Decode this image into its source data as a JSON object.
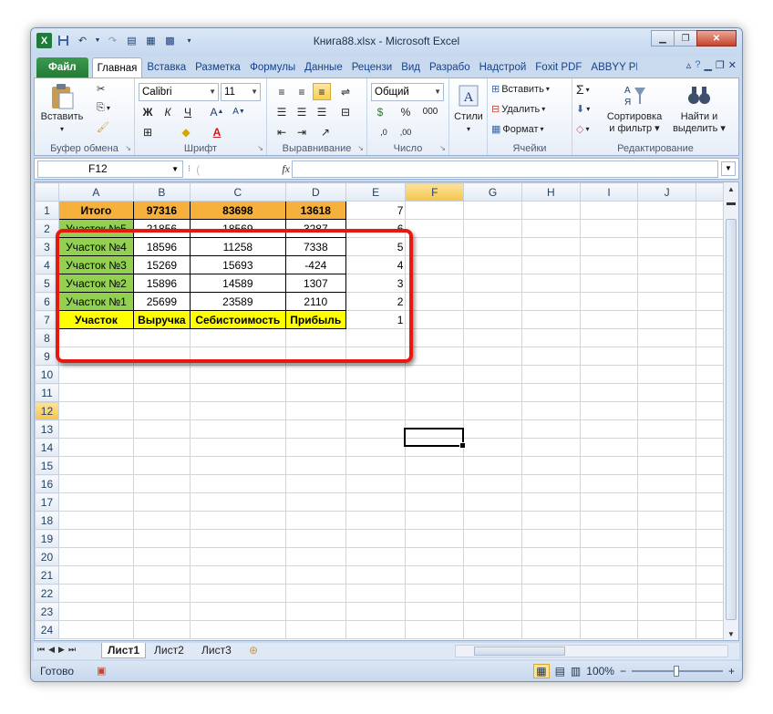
{
  "window": {
    "title": "Книга88.xlsx - Microsoft Excel"
  },
  "icons": {
    "app": "excel-icon",
    "save": "save-icon",
    "undo": "undo-icon",
    "redo": "redo-icon"
  },
  "tabs": [
    {
      "label": "Файл"
    },
    {
      "label": "Главная"
    },
    {
      "label": "Вставка"
    },
    {
      "label": "Разметка"
    },
    {
      "label": "Формулы"
    },
    {
      "label": "Данные"
    },
    {
      "label": "Рецензи"
    },
    {
      "label": "Вид"
    },
    {
      "label": "Разрабо"
    },
    {
      "label": "Надстрой"
    },
    {
      "label": "Foxit PDF"
    },
    {
      "label": "ABBYY PD"
    }
  ],
  "ribbon": {
    "clipboard": {
      "label": "Буфер обмена",
      "paste": "Вставить"
    },
    "font": {
      "label": "Шрифт",
      "name": "Calibri",
      "size": "11",
      "bold": "Ж",
      "italic": "К",
      "underline": "Ч"
    },
    "alignment": {
      "label": "Выравнивание"
    },
    "number": {
      "label": "Число",
      "format": "Общий",
      "percent": "%",
      "thousands": "000"
    },
    "styles": {
      "label": "Стили"
    },
    "cells": {
      "label": "Ячейки",
      "insert": "Вставить",
      "delete": "Удалить",
      "format": "Формат"
    },
    "editing": {
      "label": "Редактирование",
      "sort_line1": "Сортировка",
      "sort_line2": "и фильтр",
      "find_line1": "Найти и",
      "find_line2": "выделить",
      "sum": "Σ"
    }
  },
  "formula_bar": {
    "name_box": "F12",
    "fx": "fx",
    "value": ""
  },
  "grid": {
    "columns": [
      "A",
      "B",
      "C",
      "D",
      "E",
      "F",
      "G",
      "H",
      "I",
      "J"
    ],
    "rows": [
      {
        "n": "1",
        "cells": [
          "Итого",
          "97316",
          "83698",
          "13618",
          "7"
        ]
      },
      {
        "n": "2",
        "cells": [
          "Участок №5",
          "21856",
          "18569",
          "3287",
          "6"
        ]
      },
      {
        "n": "3",
        "cells": [
          "Участок №4",
          "18596",
          "11258",
          "7338",
          "5"
        ]
      },
      {
        "n": "4",
        "cells": [
          "Участок №3",
          "15269",
          "15693",
          "-424",
          "4"
        ]
      },
      {
        "n": "5",
        "cells": [
          "Участок №2",
          "15896",
          "14589",
          "1307",
          "3"
        ]
      },
      {
        "n": "6",
        "cells": [
          "Участок №1",
          "25699",
          "23589",
          "2110",
          "2"
        ]
      },
      {
        "n": "7",
        "cells": [
          "Участок",
          "Выручка",
          "Себистоимость",
          "Прибыль",
          "1"
        ]
      }
    ],
    "empty_rows": [
      "8",
      "9",
      "10",
      "11",
      "12",
      "13",
      "14",
      "15",
      "16",
      "17",
      "18",
      "19",
      "20",
      "21",
      "22",
      "23",
      "24"
    ],
    "active_cell": "F12"
  },
  "sheet_tabs": [
    {
      "label": "Лист1"
    },
    {
      "label": "Лист2"
    },
    {
      "label": "Лист3"
    }
  ],
  "status": {
    "ready": "Готово",
    "zoom": "100%",
    "zoom_out": "−",
    "zoom_in": "+"
  },
  "colors": {
    "green_fill": "#92d050",
    "orange_fill": "#f6b03c",
    "yellow_fill": "#ffff00",
    "highlight": "#e8180f"
  }
}
